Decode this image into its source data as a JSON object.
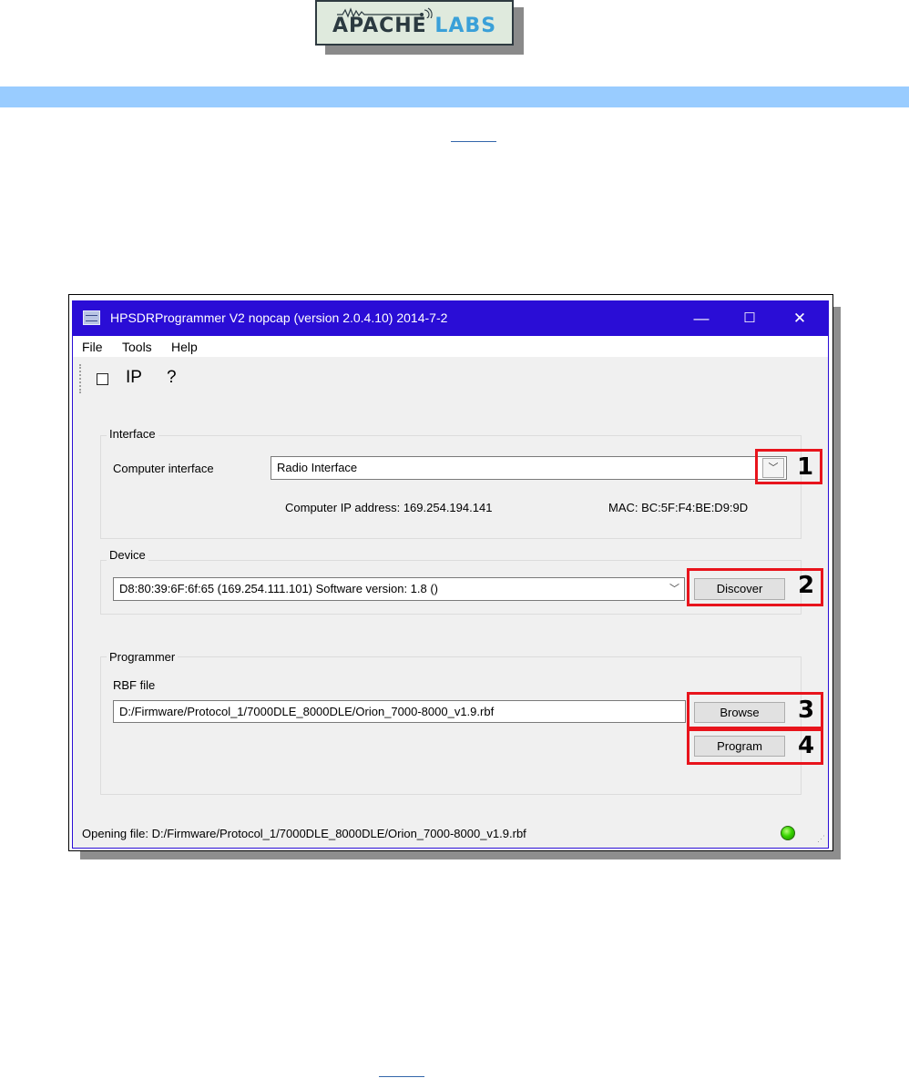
{
  "header": {
    "logo_text": [
      "APAC",
      "HE ",
      "LABS"
    ],
    "band_color": "#99ccff",
    "accent_colors": {
      "title_bar": "#2a0dd6",
      "highlight": "#e8141c",
      "status_led": "#38d400"
    }
  },
  "window": {
    "title": "HPSDRProgrammer V2 nopcap (version 2.0.4.10) 2014-7-2",
    "controls": {
      "minimize": "—",
      "maximize": "☐",
      "close": "✕"
    },
    "menu": {
      "file": "File",
      "tools": "Tools",
      "help": "Help"
    },
    "toolbar": {
      "ip": "IP",
      "help": "?"
    },
    "interface": {
      "group_label": "Interface",
      "field_label": "Computer interface",
      "selected": "Radio Interface",
      "ip_text": "Computer IP address:  169.254.194.141",
      "mac_text": "MAC:  BC:5F:F4:BE:D9:9D"
    },
    "device": {
      "group_label": "Device",
      "selected": "D8:80:39:6F:6f:65 (169.254.111.101) Software version: 1.8 ()",
      "discover_label": "Discover"
    },
    "programmer": {
      "group_label": "Programmer",
      "rbf_label": "RBF file",
      "rbf_path": "D:/Firmware/Protocol_1/7000DLE_8000DLE/Orion_7000-8000_v1.9.rbf",
      "browse_label": "Browse",
      "program_label": "Program"
    },
    "status": "Opening file: D:/Firmware/Protocol_1/7000DLE_8000DLE/Orion_7000-8000_v1.9.rbf"
  },
  "callouts": [
    "1",
    "2",
    "3",
    "4"
  ],
  "icons": [
    "app-icon",
    "minimize-icon",
    "maximize-icon",
    "close-icon",
    "checkbox-icon",
    "chevron-down-icon",
    "status-led-icon",
    "size-grip-icon"
  ]
}
